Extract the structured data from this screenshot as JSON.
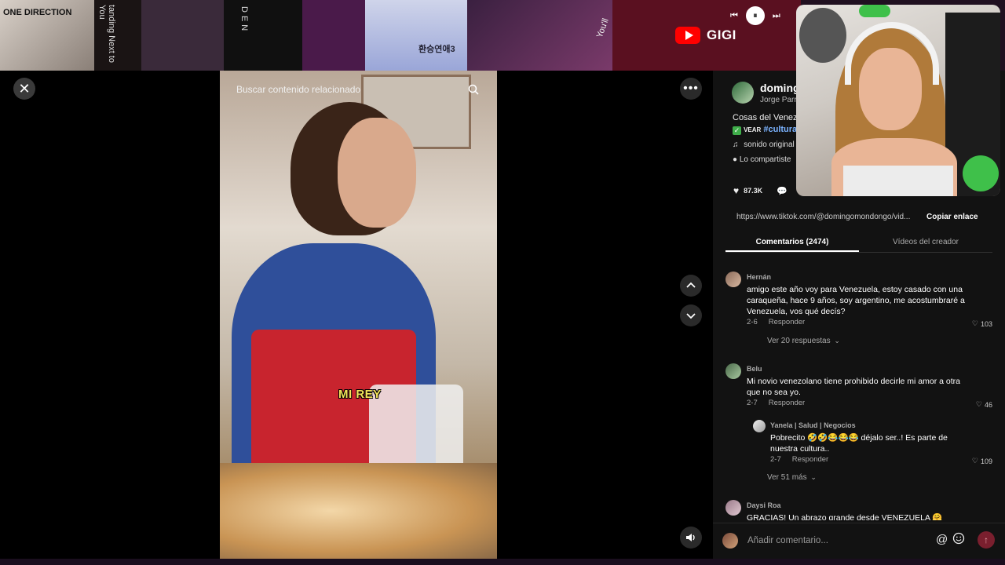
{
  "banner": {
    "tile_texts": [
      "ONE DIRECTION",
      "tanding Next to You",
      "DEN",
      "환승연애3",
      "You'll"
    ],
    "channel_name": "GIGI"
  },
  "video": {
    "search_placeholder": "Buscar contenido relacionado",
    "caption": "MI REY"
  },
  "post": {
    "username": "domingo",
    "display_name": "Jorge Parra",
    "description_line1": "Cosas del Venez",
    "vear": "VEAR",
    "hashtag": "#culturav",
    "sound": "sonido original",
    "shared": "Lo compartiste",
    "likes": "87.3K",
    "link": "https://www.tiktok.com/@domingomondongo/vid...",
    "copy_link": "Copiar enlace"
  },
  "tabs": [
    {
      "label": "Comentarios (2474)",
      "active": true
    },
    {
      "label": "Vídeos del creador",
      "active": false
    }
  ],
  "comments": [
    {
      "user": "Hernán",
      "text": "amigo este año voy para Venezuela, estoy casado con una caraqueña, hace 9 años, soy argentino, me acostumbraré a Venezuela, vos qué decís?",
      "date": "2-6",
      "reply": "Responder",
      "likes": "103",
      "view_replies": "Ver 20 respuestas"
    },
    {
      "user": "Belu",
      "text": "Mi novio venezolano tiene prohibido decirle mi amor a otra que no sea yo.",
      "date": "2-7",
      "reply": "Responder",
      "likes": "46"
    },
    {
      "user": "Yanela | Salud | Negocios",
      "text": "Pobrecito 🤣🤣😂😂😂 déjalo ser..! Es parte de nuestra cultura..",
      "date": "2-7",
      "reply": "Responder",
      "likes": "109",
      "view_more": "Ver 51 más"
    },
    {
      "user": "Daysi Roa",
      "text": "GRACIAS! Un abrazo grande desde VENEZUELA 🤗"
    }
  ],
  "comment_input": {
    "placeholder": "Añadir comentario..."
  },
  "colors": {
    "panel_bg": "#121212",
    "hashtag": "#7bb3ff",
    "youtube_red": "#ff0000",
    "apron_red": "#c8242e"
  }
}
